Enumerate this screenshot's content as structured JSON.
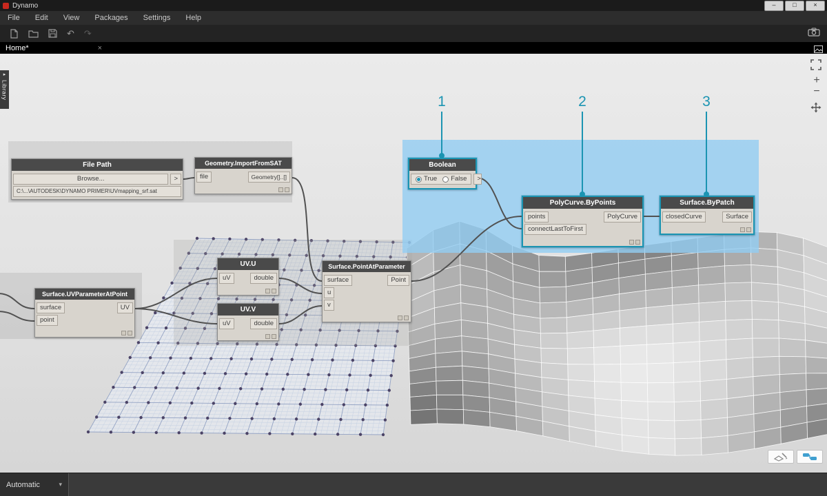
{
  "window": {
    "title": "Dynamo"
  },
  "icons": {
    "minimize": "–",
    "maximize": "□",
    "close": "×",
    "close_tab": "×",
    "caret_down": "▾",
    "undo": "↶",
    "redo": "↷",
    "library_arrow": "▸",
    "zoom_plus": "+",
    "zoom_minus": "−"
  },
  "menu": {
    "items": [
      "File",
      "Edit",
      "View",
      "Packages",
      "Settings",
      "Help"
    ]
  },
  "tabbar": {
    "home_tab": "Home*"
  },
  "canvas": {
    "library_label": "Library",
    "callouts": [
      "1",
      "2",
      "3"
    ]
  },
  "nodes": {
    "file_path": {
      "title": "File Path",
      "browse_label": "Browse...",
      "output": ">",
      "path": "C:\\...\\AUTODESK\\DYNAMO PRIMER\\UVmapping_srf.sat"
    },
    "import_sat": {
      "title": "Geometry.ImportFromSAT",
      "input": "file",
      "output": "Geometry[]..[]"
    },
    "uv_parameter": {
      "title": "Surface.UVParameterAtPoint",
      "inputs": [
        "surface",
        "point"
      ],
      "output": "UV"
    },
    "uv_u": {
      "title": "UV.U",
      "input": "uV",
      "output": "double"
    },
    "uv_v": {
      "title": "UV.V",
      "input": "uV",
      "output": "double"
    },
    "point_at_parameter": {
      "title": "Surface.PointAtParameter",
      "inputs": [
        "surface",
        "u",
        "v"
      ],
      "output": "Point"
    },
    "boolean": {
      "title": "Boolean",
      "options": [
        "True",
        "False"
      ],
      "selected": "True",
      "output": ">"
    },
    "polycurve_bypoints": {
      "title": "PolyCurve.ByPoints",
      "inputs": [
        "points",
        "connectLastToFirst"
      ],
      "output": "PolyCurve"
    },
    "surface_bypatch": {
      "title": "Surface.ByPatch",
      "inputs": [
        "closedCurve"
      ],
      "output": "Surface"
    }
  },
  "statusbar": {
    "run_mode": "Automatic"
  },
  "colors": {
    "accent_teal": "#1b94b2",
    "selection_blue": "#92cdf2",
    "node_header": "#4a4a4a",
    "node_body": "#d8d4cd",
    "wire": "#515151"
  }
}
